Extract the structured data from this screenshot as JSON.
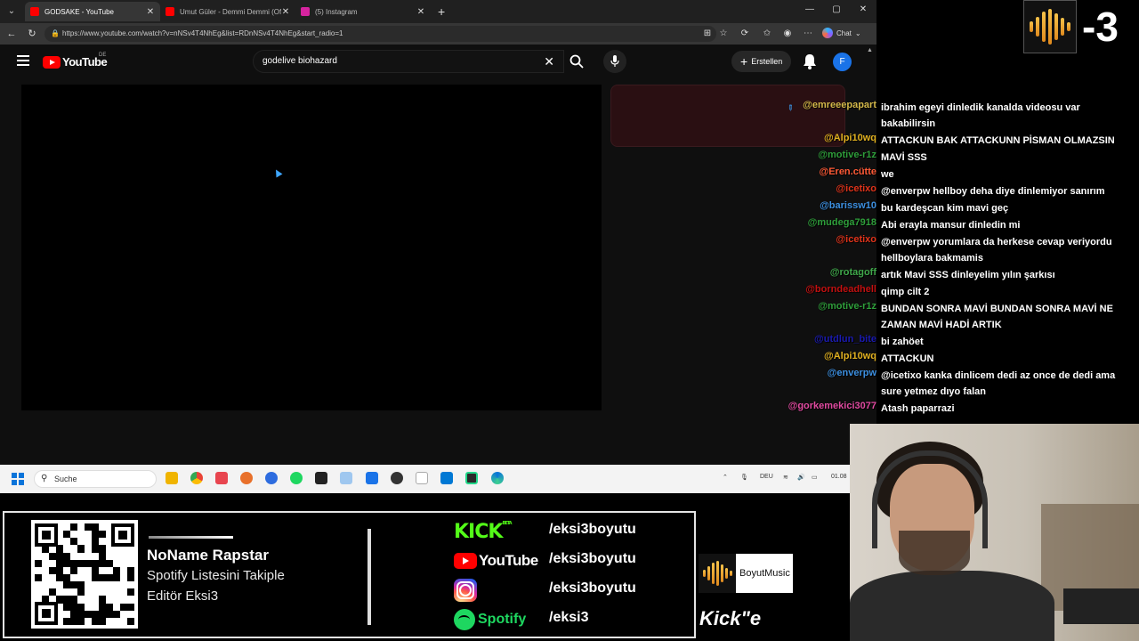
{
  "browser": {
    "tabs": [
      {
        "title": "GODSAKE - YouTube",
        "active": true,
        "favicon_color": "#ff0000"
      },
      {
        "title": "Umut Güler - Demmi Demmi (Offi",
        "active": false,
        "favicon_color": "#ff0000"
      },
      {
        "title": "(5) Instagram",
        "active": false,
        "favicon_color": "#d6249f"
      }
    ],
    "url": "https://www.youtube.com/watch?v=nNSv4T4NhEg&list=RDnNSv4T4NhEg&start_radio=1",
    "chat_label": "Chat"
  },
  "youtube": {
    "logo_text": "YouTube",
    "region": "DE",
    "search_query": "godelive biohazard",
    "create_label": "Erstellen",
    "avatar_letter": "F"
  },
  "taskbar": {
    "search_placeholder": "Suche",
    "language": "DEU",
    "date": "01.08"
  },
  "chat": {
    "messages": [
      {
        "user": "@emreeepapart",
        "color": "#d4b84a",
        "text": "ibrahim egeyi dinledik kanalda videosu var bakabilirsin"
      },
      {
        "user": "@Alpi10wq",
        "color": "#e0b020",
        "text": "ATTACKUN BAK ATTACKUNN PİSMAN OLMAZSIN"
      },
      {
        "user": "@motive-r1z",
        "color": "#2e9e3a",
        "text": "MAVİ SSS"
      },
      {
        "user": "@Eren.cütte",
        "color": "#ff5a36",
        "text": "we"
      },
      {
        "user": "@icetixo",
        "color": "#e0331a",
        "text": "@enverpw hellboy deha diye dinlemiyor sanırım"
      },
      {
        "user": "@barissw10",
        "color": "#3c8fe0",
        "text": "bu kardeşcan kim mavi geç"
      },
      {
        "user": "@mudega7918",
        "color": "#2e9e3a",
        "text": "Abi erayla mansur dinledin mi"
      },
      {
        "user": "@icetixo",
        "color": "#e0331a",
        "text": "@enverpw yorumlara da herkese cevap veriyordu hellboylara bakmamis"
      },
      {
        "user": "@rotagoff",
        "color": "#3fa84a",
        "text": "artık Mavi SSS dinleyelim yılın şarkısı"
      },
      {
        "user": "@borndeadhell",
        "color": "#c21010",
        "text": "qimp cilt 2"
      },
      {
        "user": "@motive-r1z",
        "color": "#2e9e3a",
        "text": "BUNDAN SONRA MAVİ BUNDAN SONRA MAVİ NE ZAMAN MAVİ HADİ ARTIK"
      },
      {
        "user": "@utdlun_bite",
        "color": "#1a1ab0",
        "text": "bi zahöet"
      },
      {
        "user": "@Alpi10wq",
        "color": "#e0b020",
        "text": "ATTACKUN"
      },
      {
        "user": "@enverpw",
        "color": "#3c8fe0",
        "text": "@icetixo kanka dinlicem dedi az once de dedi ama sure yetmez dıyo falan"
      },
      {
        "user": "@gorkemekici3077",
        "color": "#e04aa0",
        "text": "Atash paparrazi"
      }
    ]
  },
  "brand": {
    "number": "-3"
  },
  "banner": {
    "name": "NoName Rapstar",
    "desc_line1": "Spotify Listesini Takiple",
    "desc_line2": "Editör Eksi3",
    "socials": [
      {
        "platform": "Kick",
        "logo_text": "KICK",
        "beta": "BETA",
        "handle": "/eksi3boyutu"
      },
      {
        "platform": "YouTube",
        "logo_text": "YouTube",
        "handle": "/eksi3boyutu"
      },
      {
        "platform": "Instagram",
        "handle": "/eksi3boyutu"
      },
      {
        "platform": "Spotify",
        "logo_text": "Spotify",
        "handle": "/eksi3"
      }
    ]
  },
  "boyut": {
    "name": "BoyutMusic"
  },
  "kick_footer": "Kick\"e"
}
